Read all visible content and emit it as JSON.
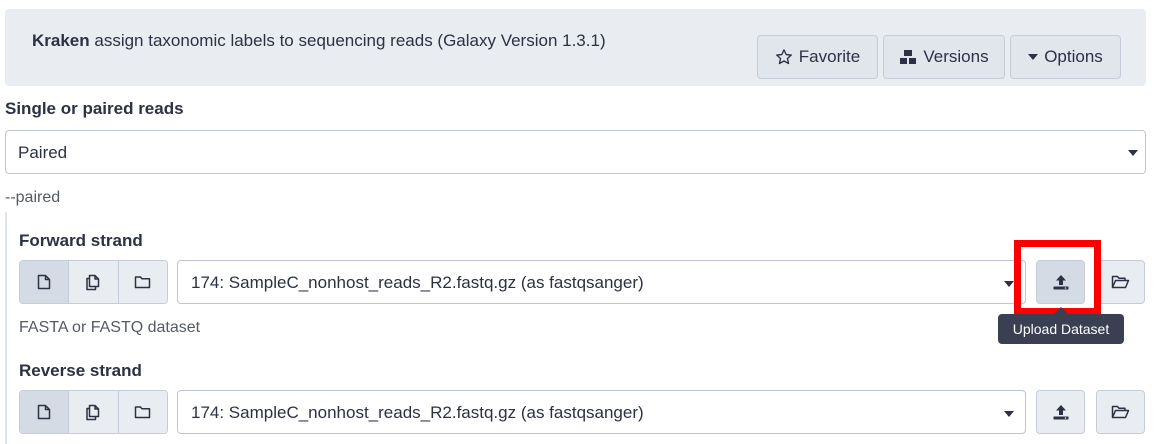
{
  "header": {
    "tool_name": "Kraken",
    "description": "assign taxonomic labels to sequencing reads (Galaxy Version 1.3.1)",
    "buttons": {
      "favorite": "Favorite",
      "versions": "Versions",
      "options": "Options"
    }
  },
  "reads_mode": {
    "label": "Single or paired reads",
    "selected": "Paired",
    "help": "--paired"
  },
  "forward": {
    "label": "Forward strand",
    "dataset": "174: SampleC_nonhost_reads_R2.fastq.gz (as fastqsanger)",
    "help": "FASTA or FASTQ dataset"
  },
  "reverse": {
    "label": "Reverse strand",
    "dataset": "174: SampleC_nonhost_reads_R2.fastq.gz (as fastqsanger)"
  },
  "tooltip": "Upload Dataset",
  "icons": [
    "star-icon",
    "cubes-icon",
    "caret-down-icon",
    "file-icon",
    "files-icon",
    "folder-icon",
    "upload-icon",
    "folder-open-icon"
  ],
  "colors": {
    "highlight": "#ff0000",
    "tooltip_bg": "#3a3f51",
    "header_bg": "#e9edf2"
  }
}
